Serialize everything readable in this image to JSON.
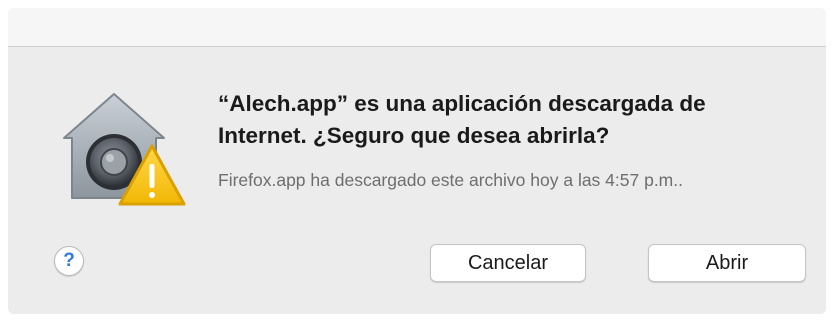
{
  "dialog": {
    "title": "“Alech.app” es una aplicación descargada de Internet. ¿Seguro que desea abrirla?",
    "message": "Firefox.app ha descargado este archivo hoy a las 4:57 p.m..",
    "help_label": "?",
    "cancel_label": "Cancelar",
    "open_label": "Abrir",
    "icon": "gatekeeper-security-icon",
    "warning_badge_icon": "warning-triangle-icon"
  },
  "colors": {
    "dialog_background": "#ececec",
    "warning_yellow": "#f6c21d",
    "help_blue": "#2f7be5"
  }
}
